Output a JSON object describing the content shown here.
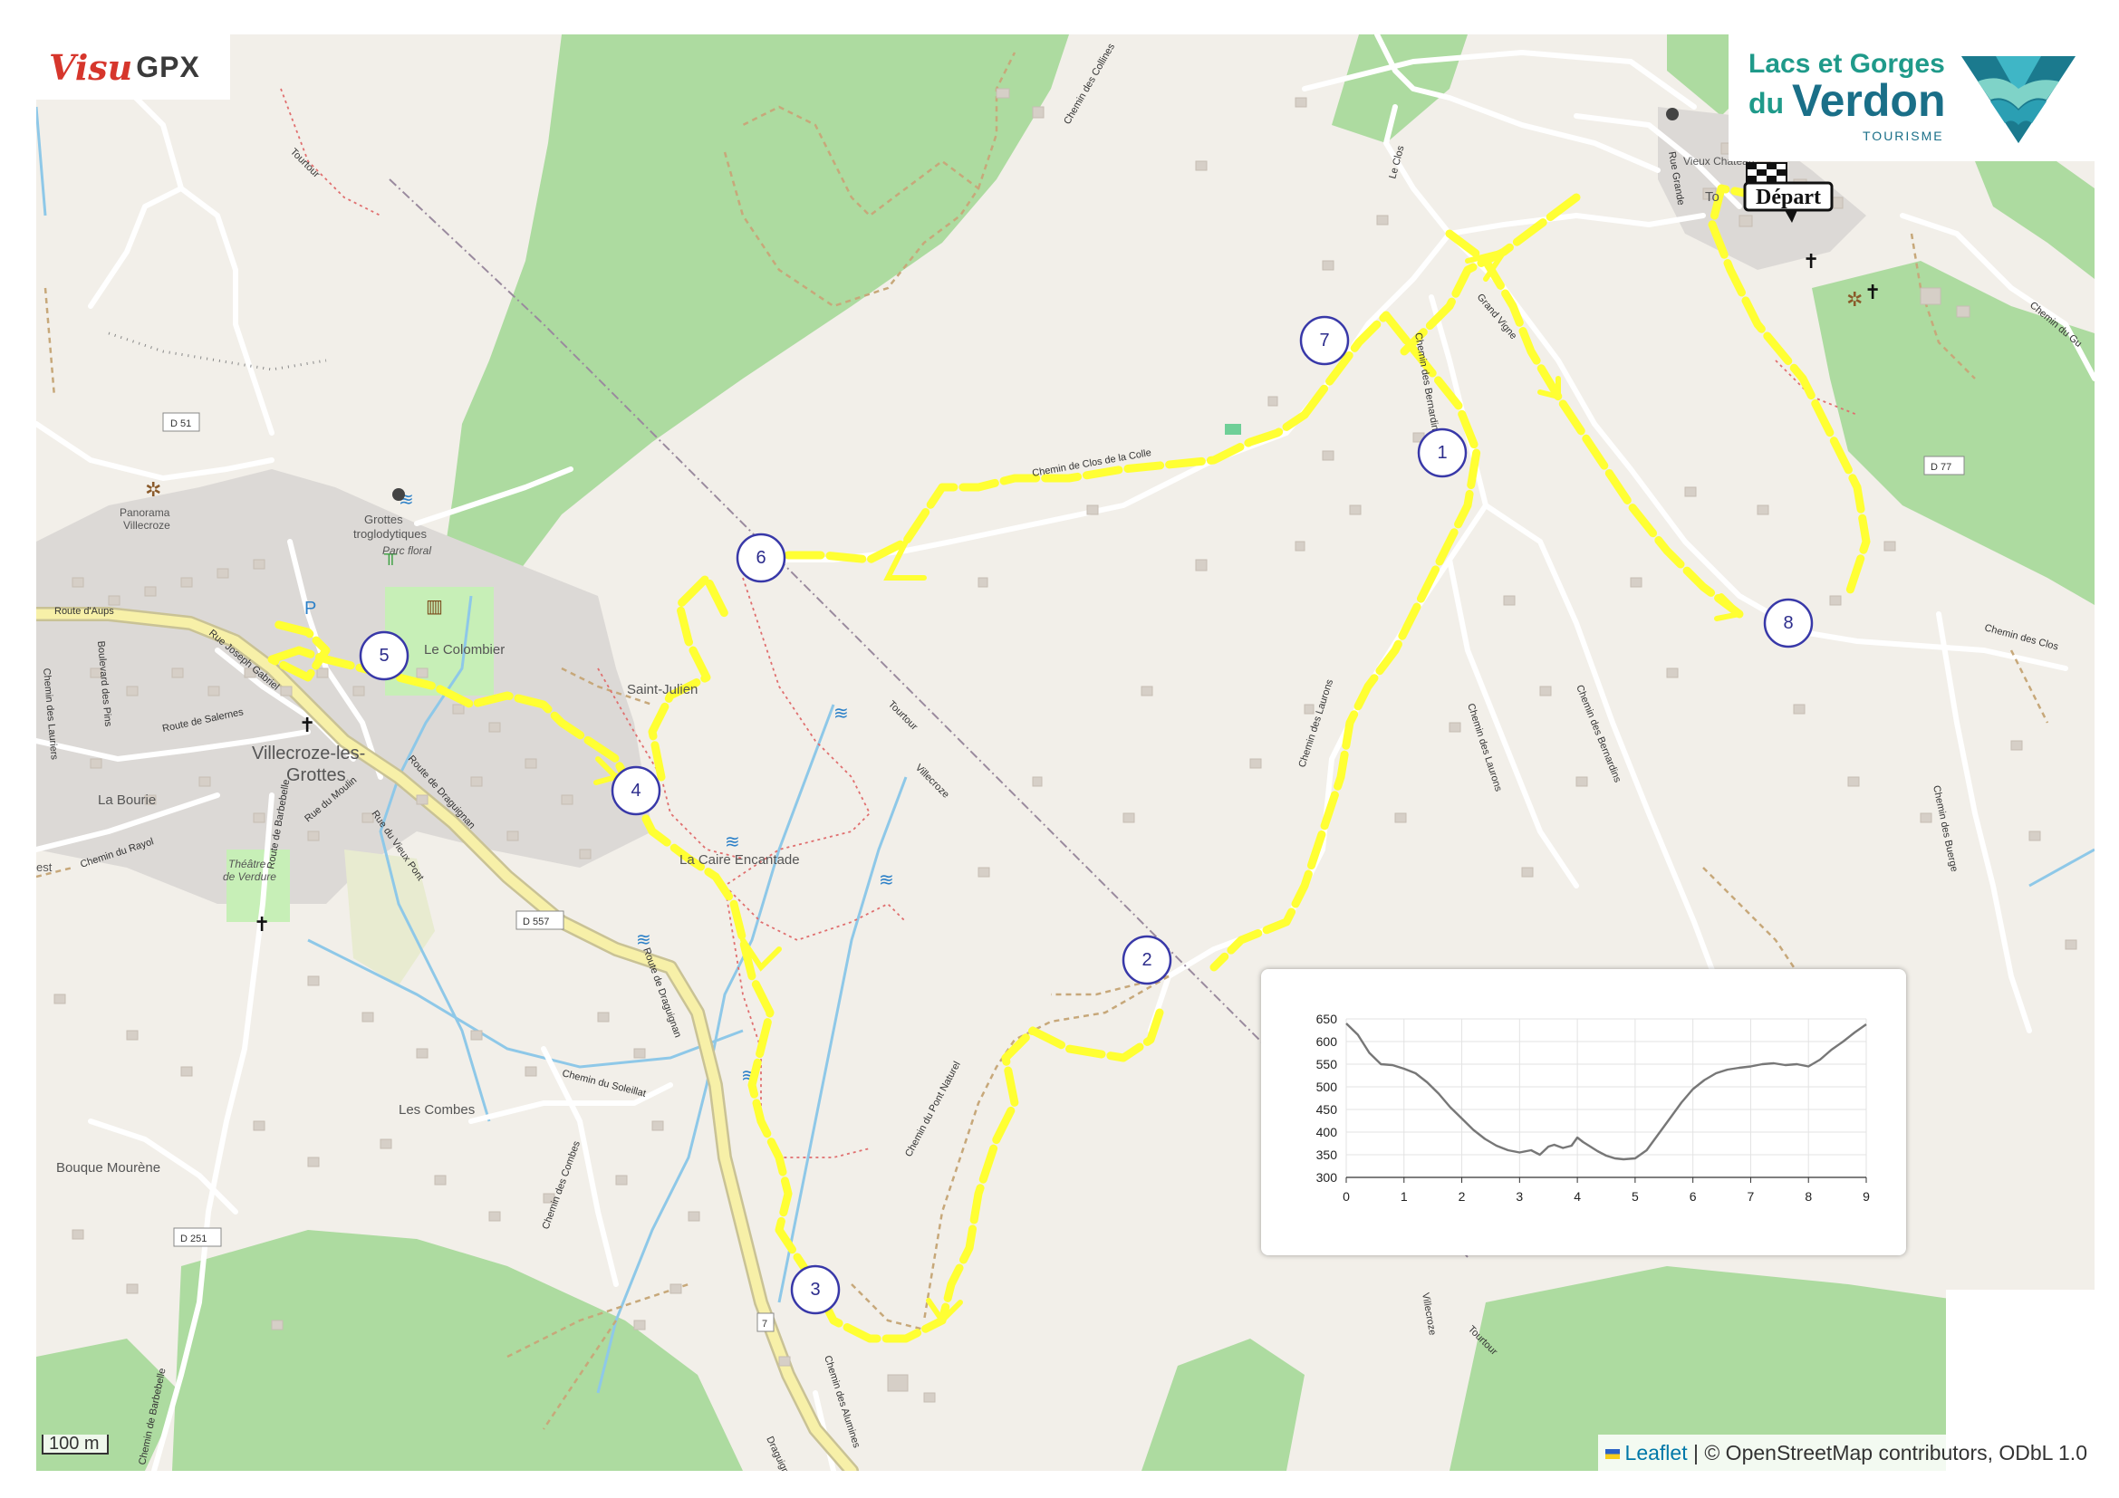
{
  "logos": {
    "visugpx": {
      "visu": "Visu",
      "gpx": "GPX"
    },
    "verdon": {
      "line1": "Lacs et Gorges",
      "line2a": "du",
      "line2b": "Verdon",
      "line3": "TOURISME"
    }
  },
  "start_label": "Départ",
  "waypoints": [
    {
      "id": "wp-1",
      "label": "1"
    },
    {
      "id": "wp-2",
      "label": "2"
    },
    {
      "id": "wp-3",
      "label": "3"
    },
    {
      "id": "wp-4",
      "label": "4"
    },
    {
      "id": "wp-5",
      "label": "5"
    },
    {
      "id": "wp-6",
      "label": "6"
    },
    {
      "id": "wp-7",
      "label": "7"
    },
    {
      "id": "wp-8",
      "label": "8"
    }
  ],
  "places": {
    "village": "Villecroze-les-Grottes",
    "village_line1": "Villecroze-les-",
    "village_line2": "Grottes",
    "saint_julien": "Saint-Julien",
    "le_colombier": "Le Colombier",
    "la_caire": "La Caire Encantade",
    "les_combes": "Les Combes",
    "bouque": "Bouque Mourène",
    "la_bourie": "La Bourie",
    "grottes_1": "Grottes",
    "grottes_2": "troglodytiques",
    "parc": "Parc floral",
    "panorama_1": "Panorama",
    "panorama_2": "Villecroze",
    "theatre_1": "Théâtre",
    "theatre_2": "de Verdure",
    "vieux_chateau": "Vieux Château",
    "tourtour_short": "To",
    "est": "est"
  },
  "roads": {
    "d51": "D 51",
    "d557": "D 557",
    "d251": "D 251",
    "d77": "D 77",
    "d7": "7",
    "route_aups": "Route d'Aups",
    "route_draguignan": "Route de Draguignan",
    "route_draguignan_2": "Route de Draguignan",
    "route_salernes": "Route de Salernes",
    "route_moulin": "Rue du Moulin",
    "rue_vieux_pont": "Rue du Vieux Pont",
    "chemin_rayol": "Chemin du Rayol",
    "chemin_soleillat": "Chemin du Soleillat",
    "chemin_combes": "Chemin des Combes",
    "chemin_pont": "Chemin du Pont Naturel",
    "chemin_alumines": "Chemin des Alumines",
    "chemin_collines": "Chemin des Collines",
    "chemin_clos_colle": "Chemin de Clos de la Colle",
    "chemin_bernardins": "Chemin des Bernardins",
    "chemin_bernardins_2": "Chemin des Bernardins",
    "chemin_laurons": "Chemin des Laurons",
    "chemin_laurons_2": "Chemin des Laurons",
    "chemin_clos": "Chemin des Clos",
    "chemin_buerge": "Chemin des Buerge",
    "grand_vigne": "Grand Vigne",
    "le_clos": "Le Clos",
    "tourtour_1": "Tourtour",
    "tourtour_2": "Tourtour",
    "tourtour_3": "Tourtour",
    "villecroze_path": "Villecroze",
    "villecroze_path_2": "Villecroze",
    "bd_pins": "Boulevard des Pins",
    "rue_gabriel": "Rue Joseph Gabriel",
    "chemin_lauriers": "Chemin des Lauriers",
    "route_barbebelle": "Route de Barbebelle",
    "rue_grande": "Rue Grande",
    "chemin_gu": "Chemin du Gu",
    "chemin_barbebelle": "Chemin de Barbebelle",
    "draguignan_short": "Draguignan"
  },
  "scale": {
    "label": "100 m"
  },
  "attribution": {
    "leaflet": "Leaflet",
    "rest": " | © OpenStreetMap contributors, ODbL 1.0"
  },
  "colors": {
    "route": "#ffff33",
    "marker": "#3838a8",
    "forest": "#a8d49a",
    "urban": "#d9d6d3",
    "road": "#ffffff",
    "main_road": "#f6f1a6",
    "water": "#8bc6e6"
  },
  "chart_data": {
    "type": "line",
    "title": "",
    "xlabel": "",
    "ylabel": "",
    "xlim": [
      0,
      9
    ],
    "ylim": [
      300,
      650
    ],
    "xticks": [
      0,
      1,
      2,
      3,
      4,
      5,
      6,
      7,
      8,
      9
    ],
    "yticks": [
      300,
      350,
      400,
      450,
      500,
      550,
      600,
      650
    ],
    "grid": true,
    "series": [
      {
        "x": [
          0,
          0.2,
          0.4,
          0.6,
          0.8,
          1.0,
          1.2,
          1.4,
          1.6,
          1.8,
          2.0,
          2.2,
          2.4,
          2.6,
          2.8,
          3.0,
          3.2,
          3.35,
          3.5,
          3.6,
          3.75,
          3.9,
          4.0,
          4.1,
          4.2,
          4.35,
          4.5,
          4.65,
          4.8,
          5.0,
          5.2,
          5.4,
          5.6,
          5.8,
          6.0,
          6.2,
          6.4,
          6.6,
          6.8,
          7.0,
          7.2,
          7.4,
          7.6,
          7.8,
          8.0,
          8.2,
          8.4,
          8.6,
          8.8,
          9.0
        ],
        "y": [
          640,
          615,
          575,
          550,
          548,
          540,
          530,
          510,
          485,
          455,
          430,
          405,
          385,
          370,
          360,
          355,
          360,
          350,
          368,
          372,
          365,
          370,
          388,
          378,
          370,
          358,
          348,
          342,
          340,
          342,
          360,
          395,
          430,
          465,
          495,
          515,
          530,
          538,
          542,
          545,
          550,
          552,
          548,
          550,
          545,
          560,
          582,
          600,
          620,
          638
        ]
      }
    ]
  }
}
